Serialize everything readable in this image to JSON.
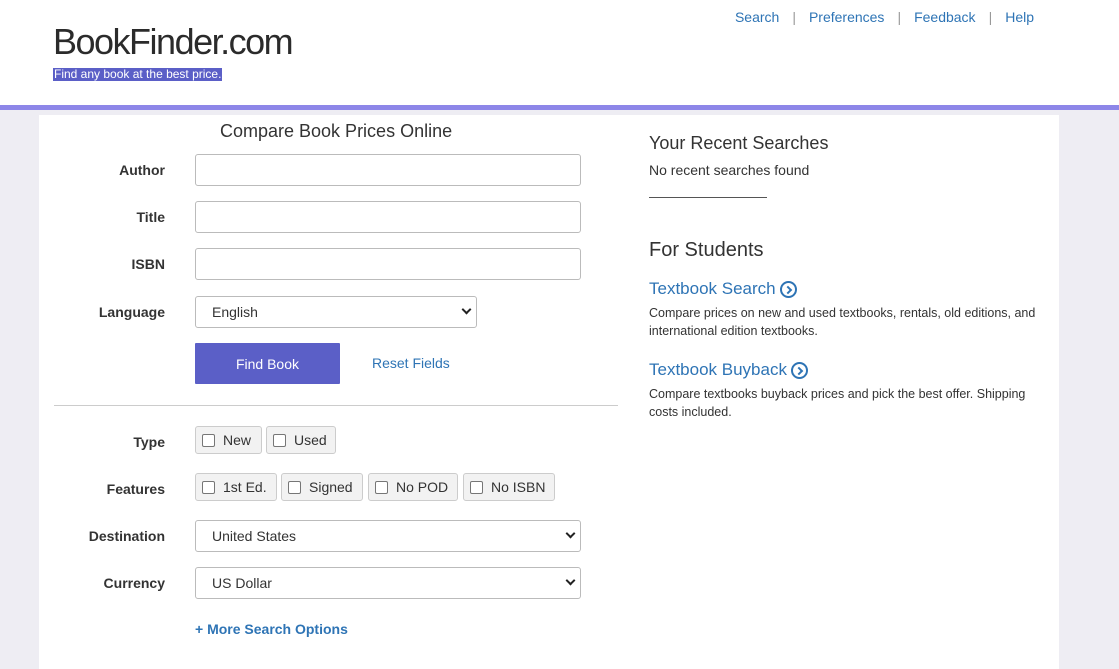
{
  "header": {
    "logo": "BookFinder.com",
    "tagline": "Find any book at the best price.",
    "nav": [
      "Search",
      "Preferences",
      "Feedback",
      "Help"
    ]
  },
  "form": {
    "title": "Compare Book Prices Online",
    "author_label": "Author",
    "title_label": "Title",
    "isbn_label": "ISBN",
    "language_label": "Language",
    "language_value": "English",
    "find_button": "Find Book",
    "reset_link": "Reset Fields",
    "type_label": "Type",
    "type_options": [
      "New",
      "Used"
    ],
    "features_label": "Features",
    "features_options": [
      "1st Ed.",
      "Signed",
      "No POD",
      "No ISBN"
    ],
    "destination_label": "Destination",
    "destination_value": "United States",
    "currency_label": "Currency",
    "currency_value": "US Dollar",
    "more_options": "+ More Search Options"
  },
  "sidebar": {
    "recent_title": "Your Recent Searches",
    "recent_empty": "No recent searches found",
    "students_title": "For Students",
    "textbook_search": "Textbook Search",
    "textbook_search_desc": "Compare prices on new and used textbooks, rentals, old editions, and international edition textbooks.",
    "textbook_buyback": "Textbook Buyback",
    "textbook_buyback_desc": "Compare textbooks buyback prices and pick the best offer. Shipping costs included."
  },
  "colors": {
    "accent": "#5b5fc7",
    "header_border": "#8d86e8",
    "link": "#2e74b5"
  }
}
